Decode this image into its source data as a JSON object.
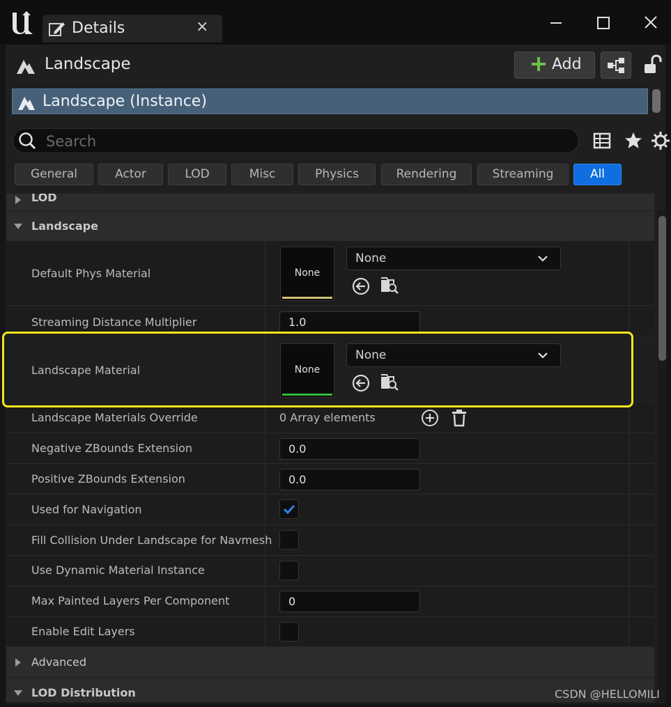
{
  "window": {
    "tab_title": "Details",
    "close_tab": "×"
  },
  "header": {
    "actor_name": "Landscape",
    "add_label": "Add"
  },
  "component": {
    "name": "Landscape (Instance)"
  },
  "search": {
    "placeholder": "Search",
    "value": ""
  },
  "filter_tabs": [
    "General",
    "Actor",
    "LOD",
    "Misc",
    "Physics",
    "Rendering",
    "Streaming",
    "All"
  ],
  "active_filter": "All",
  "categories": {
    "lod": "LOD",
    "landscape": "Landscape",
    "advanced": "Advanced",
    "lod_distribution": "LOD Distribution"
  },
  "properties": {
    "default_phys_material": {
      "label": "Default Phys Material",
      "thumb": "None",
      "value": "None"
    },
    "streaming_distance_multiplier": {
      "label": "Streaming Distance Multiplier",
      "value": "1.0"
    },
    "landscape_material": {
      "label": "Landscape Material",
      "thumb": "None",
      "value": "None"
    },
    "landscape_materials_override": {
      "label": "Landscape Materials Override",
      "value": "0 Array elements"
    },
    "negative_zbounds": {
      "label": "Negative ZBounds Extension",
      "value": "0.0"
    },
    "positive_zbounds": {
      "label": "Positive ZBounds Extension",
      "value": "0.0"
    },
    "used_for_navigation": {
      "label": "Used for Navigation",
      "checked": true
    },
    "fill_collision": {
      "label": "Fill Collision Under Landscape for Navmesh",
      "checked": false
    },
    "use_dynamic_material_instance": {
      "label": "Use Dynamic Material Instance",
      "checked": false
    },
    "max_painted_layers": {
      "label": "Max Painted Layers Per Component",
      "value": "0"
    },
    "enable_edit_layers": {
      "label": "Enable Edit Layers",
      "checked": false
    }
  },
  "colors": {
    "accent_blue": "#0f6ee0",
    "highlight_yellow": "#f4e51c",
    "phys_material_bar": "#cbbf7a",
    "material_bar": "#35b83c",
    "selection_row": "#46607a"
  },
  "watermark": "CSDN @HELLOMILI"
}
